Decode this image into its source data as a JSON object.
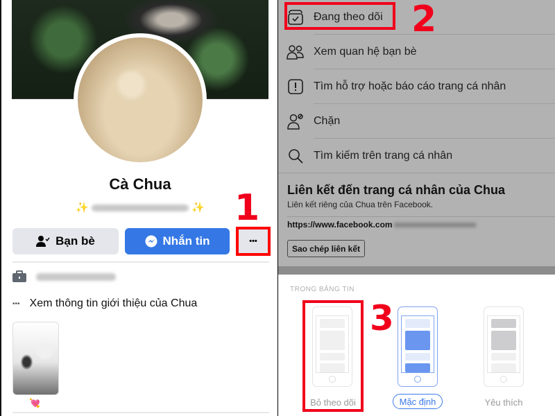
{
  "left": {
    "profile_name": "Cà Chua",
    "bio_prefix": "✨",
    "bio_suffix": "✨",
    "buttons": {
      "friends_label": "Bạn bè",
      "message_label": "Nhắn tin",
      "more_label": "•••"
    },
    "step_marker": "1",
    "intro": {
      "more_glyph": "•••",
      "label": "Xem thông tin giới thiệu của Chua"
    },
    "featured_emoji": "💘"
  },
  "right": {
    "menu": [
      {
        "icon": "following-icon",
        "label": "Đang theo dõi"
      },
      {
        "icon": "friendship-icon",
        "label": "Xem quan hệ bạn bè"
      },
      {
        "icon": "report-icon",
        "label": "Tìm hỗ trợ hoặc báo cáo trang cá nhân"
      },
      {
        "icon": "block-icon",
        "label": "Chặn"
      },
      {
        "icon": "search-icon",
        "label": "Tìm kiếm trên trang cá nhân"
      }
    ],
    "step2": "2",
    "link_section": {
      "title": "Liên kết đến trang cá nhân của Chua",
      "subtitle": "Liên kết riêng của Chua trên Facebook.",
      "url": "https://www.facebook.com",
      "copy_label": "Sao chép liên kết"
    },
    "news_feed": {
      "title": "TRONG BẢNG TIN",
      "options": [
        {
          "label": "Bỏ theo dõi",
          "selected": false
        },
        {
          "label": "Mặc định",
          "selected": true
        },
        {
          "label": "Yêu thích",
          "selected": false
        }
      ],
      "step3": "3"
    }
  },
  "colors": {
    "highlight_red": "#f1001c",
    "messenger_blue": "#3578e5",
    "menu_bg": "#b2b2b2"
  }
}
